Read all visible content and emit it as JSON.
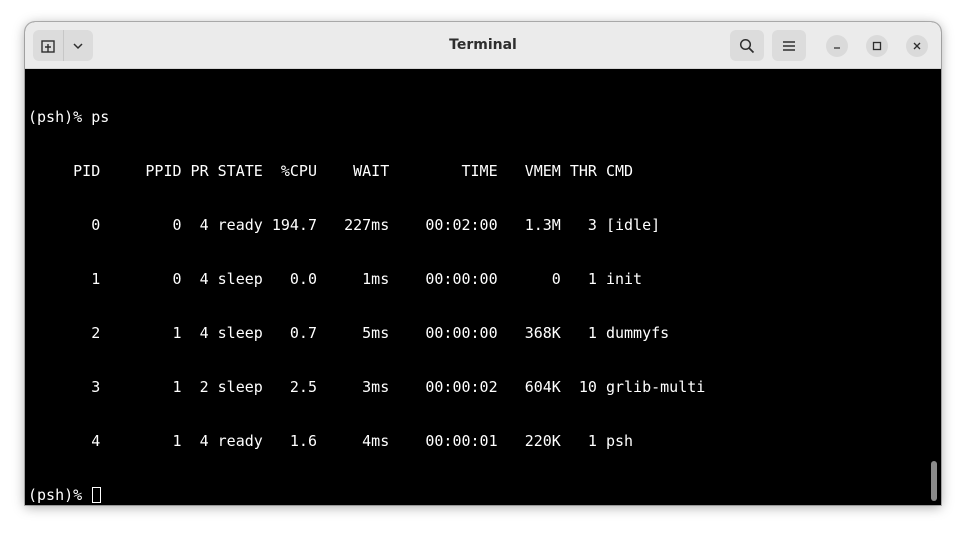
{
  "window": {
    "title": "Terminal"
  },
  "header": {
    "new_tab_icon": "new-tab-icon",
    "menu_dropdown_icon": "chevron-down-icon",
    "search_icon": "search-icon",
    "hamburger_icon": "hamburger-menu-icon",
    "minimize_icon": "minimize-icon",
    "maximize_icon": "maximize-icon",
    "close_icon": "close-icon"
  },
  "terminal": {
    "lines": [
      "(psh)% ps",
      "     PID     PPID PR STATE  %CPU    WAIT        TIME   VMEM THR CMD",
      "       0        0  4 ready 194.7   227ms    00:02:00   1.3M   3 [idle]",
      "       1        0  4 sleep   0.0     1ms    00:00:00      0   1 init",
      "       2        1  4 sleep   0.7     5ms    00:00:00   368K   1 dummyfs",
      "       3        1  2 sleep   2.5     3ms    00:00:02   604K  10 grlib-multi",
      "       4        1  4 ready   1.6     4ms    00:00:01   220K   1 psh"
    ],
    "prompt": "(psh)% "
  },
  "colors": {
    "terminal_bg": "#000000",
    "terminal_fg": "#ffffff",
    "titlebar_bg": "#ebebeb"
  }
}
